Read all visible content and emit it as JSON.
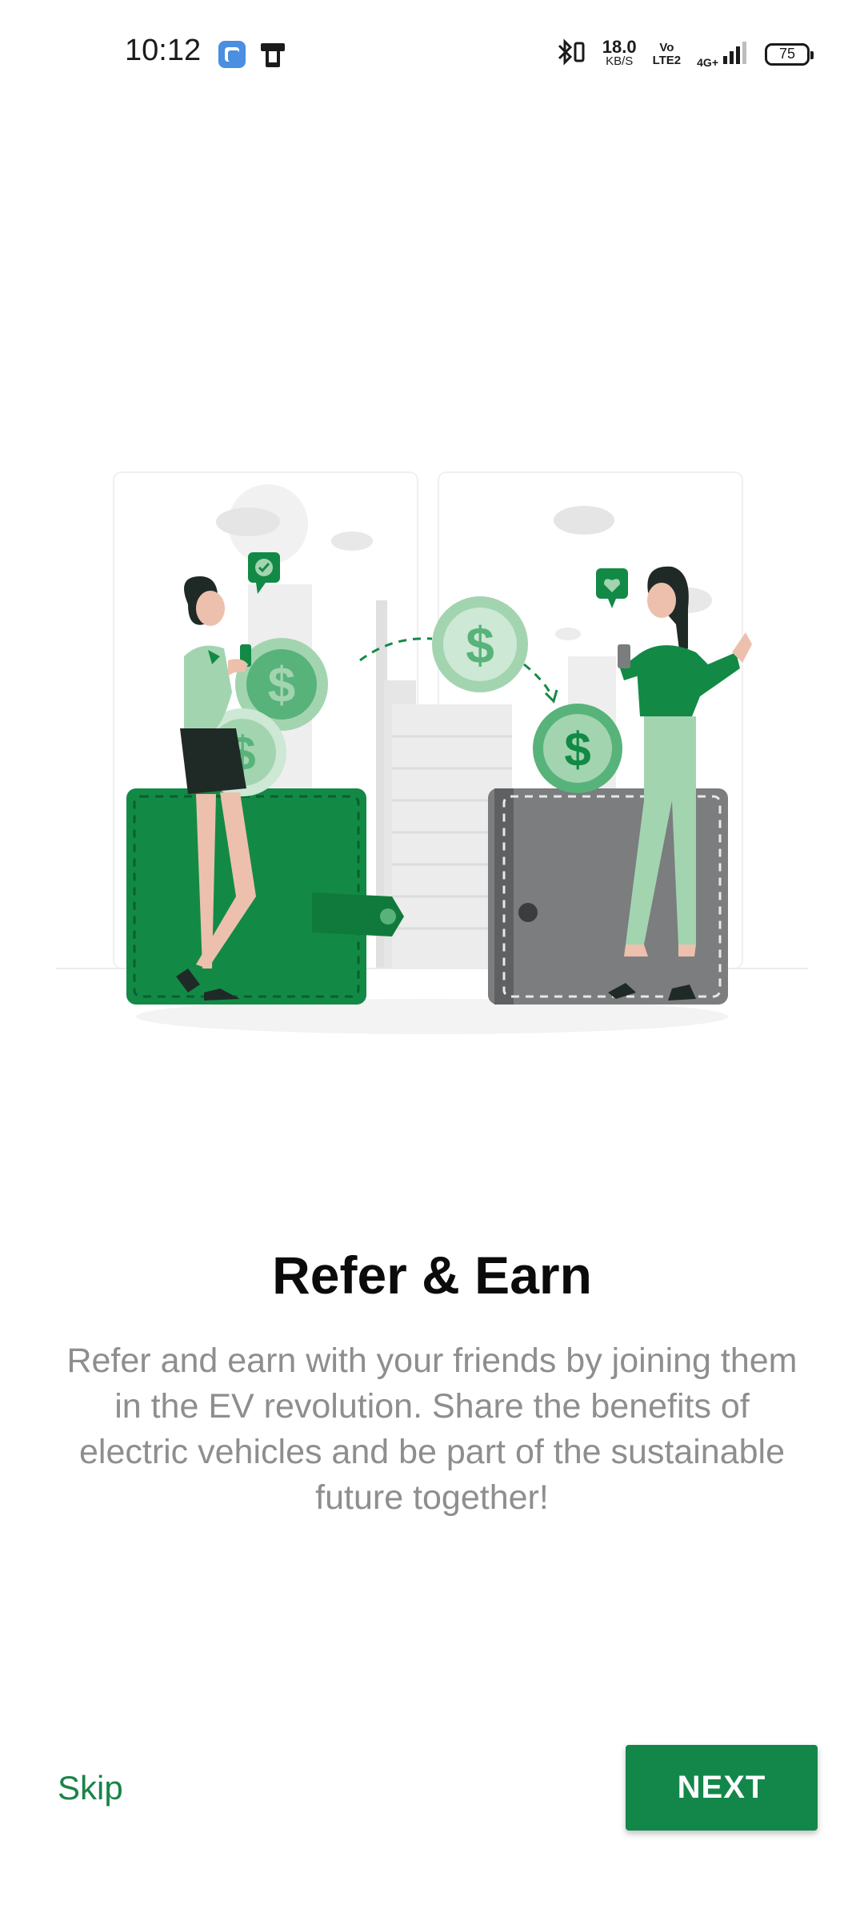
{
  "status_bar": {
    "time": "10:12",
    "net_speed_value": "18.0",
    "net_speed_unit": "KB/S",
    "volte_top": "Vo",
    "volte_bottom": "LTE2",
    "network": "4G+",
    "battery": "75"
  },
  "onboarding": {
    "title": "Refer & Earn",
    "description": "Refer and earn with your friends by joining them in the EV revolution. Share the benefits of electric vehicles and be part of the sustainable future together!"
  },
  "actions": {
    "skip_label": "Skip",
    "next_label": "NEXT"
  },
  "colors": {
    "brand_green": "#13874a",
    "light_green": "#a3d4b0",
    "text_gray": "#8e8e8e"
  }
}
